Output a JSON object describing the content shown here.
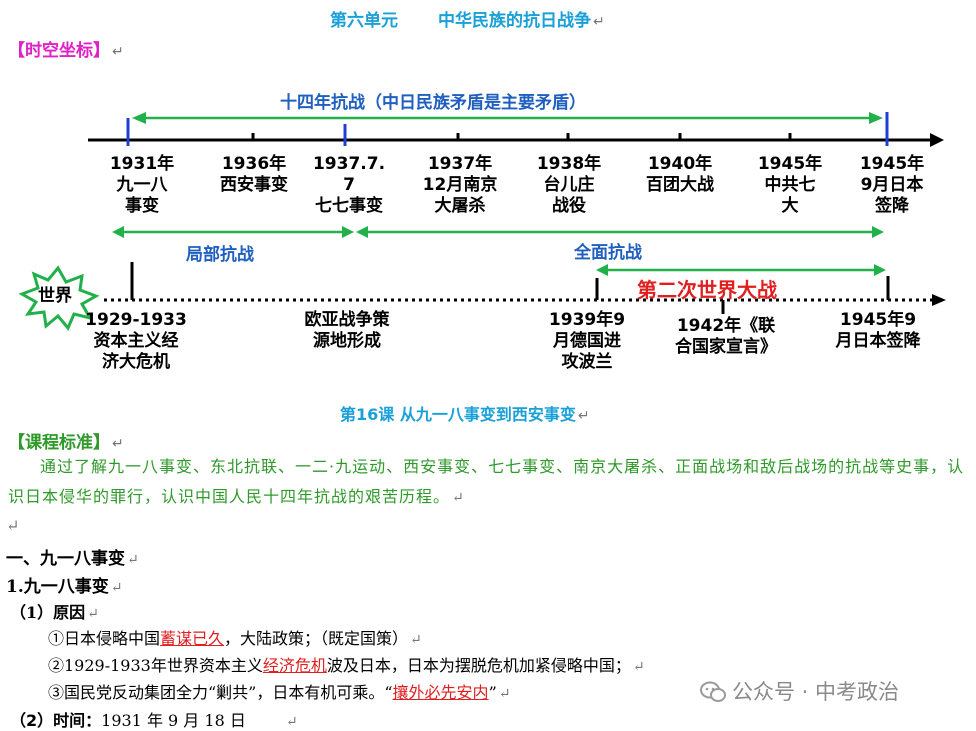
{
  "unit_title": {
    "left": "第六单元",
    "right": "中华民族的抗日战争"
  },
  "return_mark": "↵",
  "spacetime_tag": "【时空坐标】",
  "timeline": {
    "top_span": "十四年抗战（中日民族矛盾是主要矛盾）",
    "events": [
      {
        "label": "1931年\n九一八\n事变"
      },
      {
        "label": "1936年\n西安事变"
      },
      {
        "label": "1937.7.\n7\n七七事变"
      },
      {
        "label": "1937年\n12月南京\n大屠杀"
      },
      {
        "label": "1938年\n台儿庄\n战役"
      },
      {
        "label": "1940年\n百团大战"
      },
      {
        "label": "1945年\n中共七\n大"
      },
      {
        "label": "1945年\n9月日本\n签降"
      }
    ],
    "partial_war": "局部抗战",
    "full_war": "全面抗战",
    "world_label": "世界",
    "ww2": "第二次世界大战",
    "world_events": [
      {
        "label": "1929-1933\n资本主义经\n济大危机"
      },
      {
        "label": "欧亚战争策\n源地形成"
      },
      {
        "label": "1939年9\n月德国进\n攻波兰"
      },
      {
        "label": "1942年《联\n合国家宣言》"
      },
      {
        "label": "1945年9\n月日本签降"
      }
    ],
    "colors": {
      "axis": "#000000",
      "arrow_green": "#22b04a",
      "marker_blue": "#1f3fd0",
      "blue_text": "#1f5fbf",
      "red_text": "#e02020"
    }
  },
  "lesson_title": "第16课  从九一八事变到西安事变",
  "standard_tag": "【课程标准】",
  "standard_text": "通过了解九一八事变、东北抗联、一二·九运动、西安事变、七七事变、南京大屠杀、正面战场和敌后战场的抗战等史事，认识日本侵华的罪行，认识中国人民十四年抗战的艰苦历程。",
  "section1": "一、九一八事变",
  "sub1": "1.九一八事变",
  "cause_heading": "（1）原因",
  "cause1": {
    "pre": "①日本侵略中国",
    "key": "蓄谋已久",
    "post": "，大陆政策；（既定国策）"
  },
  "cause2": {
    "pre": "②1929-1933年世界资本主义",
    "key": "经济危机",
    "post": "波及日本，日本为摆脱危机加紧侵略中国；"
  },
  "cause3": {
    "pre": "③国民党反动集团全力“剿共”，日本有机可乘。“",
    "key": "攘外必先安内",
    "post": "”"
  },
  "time_heading": "（2）时间：",
  "time_value": "1931 年 9 月 18 日",
  "watermark": "公众号 · 中考政治"
}
